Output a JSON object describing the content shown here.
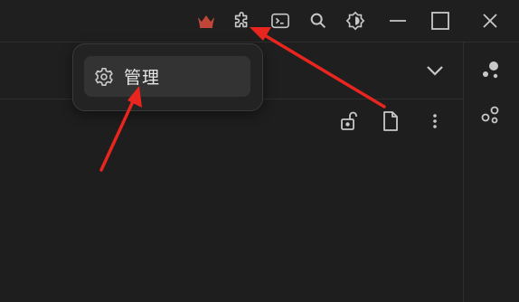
{
  "titlebar": {
    "icons": [
      "crown-icon",
      "puzzle-icon",
      "terminal-icon",
      "search-icon",
      "theme-icon",
      "minimize-icon",
      "maximize-icon",
      "close-icon"
    ],
    "accent_color": "#c0463a"
  },
  "popup_menu": {
    "items": [
      {
        "label": "管理",
        "icon": "gear-icon"
      }
    ]
  },
  "doc_toolbar": {
    "icons": [
      "unlock-icon",
      "file-icon",
      "more-vertical-icon"
    ]
  },
  "sidebar": {
    "icons": [
      "graph-dots-icon",
      "nodes-icon"
    ]
  },
  "annotation_color": "#e8251e"
}
